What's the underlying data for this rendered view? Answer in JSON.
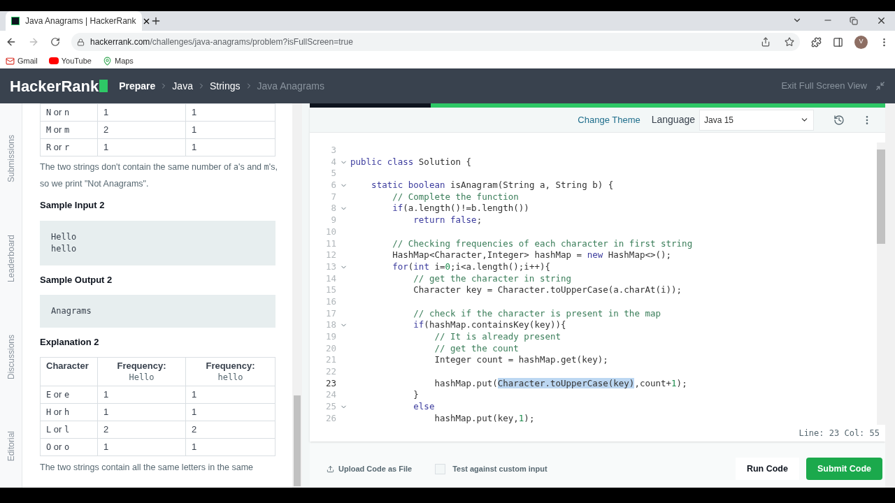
{
  "browser": {
    "tab_title": "Java Anagrams | HackerRank",
    "url_domain": "hackerrank.com",
    "url_path": "/challenges/java-anagrams/problem?isFullScreen=true",
    "bookmarks": [
      "Gmail",
      "YouTube",
      "Maps"
    ],
    "avatar": "V"
  },
  "header": {
    "logo": "HackerRank",
    "breadcrumbs": [
      {
        "label": "Prepare",
        "current": false
      },
      {
        "label": "Java",
        "current": false
      },
      {
        "label": "Strings",
        "current": false
      },
      {
        "label": "Java Anagrams",
        "current": true
      }
    ],
    "exit": "Exit Full Screen View"
  },
  "side_tabs": [
    "Submissions",
    "Leaderboard",
    "Discussions",
    "Editorial"
  ],
  "problem": {
    "table1_rows": [
      {
        "upper": "N",
        "joiner": "or",
        "lower": "n",
        "count_1": "1",
        "count_2": "1"
      },
      {
        "upper": "M",
        "joiner": "or",
        "lower": "m",
        "count_1": "2",
        "count_2": "1"
      },
      {
        "upper": "R",
        "joiner": "or",
        "lower": "r",
        "count_1": "1",
        "count_2": "1"
      }
    ],
    "para1": [
      {
        "text": "The two strings don't contain the same number of ",
        "kind": "text"
      },
      {
        "text": "a",
        "kind": "code"
      },
      {
        "text": "'s and ",
        "kind": "text"
      },
      {
        "text": "m",
        "kind": "code"
      },
      {
        "text": "'s, so we print \"Not Anagrams\".",
        "kind": "text"
      }
    ],
    "sample_input_title": "Sample Input 2",
    "sample_input": [
      "Hello",
      "hello"
    ],
    "sample_output_title": "Sample Output 2",
    "sample_output": [
      "Anagrams"
    ],
    "explanation_title": "Explanation 2",
    "table2_header": [
      {
        "title": "Character"
      },
      {
        "title": "Frequency:",
        "sub": "Hello"
      },
      {
        "title": "Frequency:",
        "sub": "hello"
      }
    ],
    "table2_rows": [
      {
        "upper": "E",
        "joiner": "or",
        "lower": "e",
        "count_1": "1",
        "count_2": "1"
      },
      {
        "upper": "H",
        "joiner": "or",
        "lower": "h",
        "count_1": "1",
        "count_2": "1"
      },
      {
        "upper": "L",
        "joiner": "or",
        "lower": "l",
        "count_1": "2",
        "count_2": "2"
      },
      {
        "upper": "O",
        "joiner": "or",
        "lower": "o",
        "count_1": "1",
        "count_2": "1"
      }
    ],
    "para2": "The two strings contain all the same letters in the same"
  },
  "editor": {
    "change_theme": "Change Theme",
    "language_label": "Language",
    "language": "Java 15",
    "status": "Line: 23 Col: 55",
    "lines": [
      {
        "num": "3",
        "fold": false,
        "current": false
      },
      {
        "num": "4",
        "fold": true,
        "current": false,
        "tokens": [
          {
            "t": "public class",
            "kind": "keyword"
          },
          {
            "t": " Solution {",
            "kind": "plain"
          }
        ]
      },
      {
        "num": "5",
        "fold": false,
        "current": false
      },
      {
        "num": "6",
        "fold": true,
        "current": false,
        "tokens": [
          {
            "t": "    static boolean",
            "kind": "keyword"
          },
          {
            "t": " isAnagram(String a, String b) {",
            "kind": "plain"
          }
        ]
      },
      {
        "num": "7",
        "fold": false,
        "current": false,
        "tokens": [
          {
            "t": "        // Complete the function",
            "kind": "comment"
          }
        ]
      },
      {
        "num": "8",
        "fold": true,
        "current": false,
        "tokens": [
          {
            "t": "        if",
            "kind": "keyword"
          },
          {
            "t": "(a.length()!=b.length())",
            "kind": "plain"
          }
        ]
      },
      {
        "num": "9",
        "fold": false,
        "current": false,
        "tokens": [
          {
            "t": "            return false",
            "kind": "keyword"
          },
          {
            "t": ";",
            "kind": "plain"
          }
        ]
      },
      {
        "num": "10",
        "fold": false,
        "current": false
      },
      {
        "num": "11",
        "fold": false,
        "current": false,
        "tokens": [
          {
            "t": "        // Checking frequencies of each character in first string",
            "kind": "comment"
          }
        ]
      },
      {
        "num": "12",
        "fold": false,
        "current": false,
        "tokens": [
          {
            "t": "        HashMap<Character,Integer> hashMap = ",
            "kind": "plain"
          },
          {
            "t": "new",
            "kind": "keyword"
          },
          {
            "t": " HashMap<>();",
            "kind": "plain"
          }
        ]
      },
      {
        "num": "13",
        "fold": true,
        "current": false,
        "tokens": [
          {
            "t": "        for",
            "kind": "keyword"
          },
          {
            "t": "(",
            "kind": "plain"
          },
          {
            "t": "int",
            "kind": "keyword"
          },
          {
            "t": " i=",
            "kind": "plain"
          },
          {
            "t": "0",
            "kind": "number"
          },
          {
            "t": ";i<a.length();i++){",
            "kind": "plain"
          }
        ]
      },
      {
        "num": "14",
        "fold": false,
        "current": false,
        "tokens": [
          {
            "t": "            // get the character in string",
            "kind": "comment"
          }
        ]
      },
      {
        "num": "15",
        "fold": false,
        "current": false,
        "tokens": [
          {
            "t": "            Character key = Character.toUpperCase(a.charAt(i));",
            "kind": "plain"
          }
        ]
      },
      {
        "num": "16",
        "fold": false,
        "current": false
      },
      {
        "num": "17",
        "fold": false,
        "current": false,
        "tokens": [
          {
            "t": "            // check if the character is present in the map",
            "kind": "comment"
          }
        ]
      },
      {
        "num": "18",
        "fold": true,
        "current": false,
        "tokens": [
          {
            "t": "            if",
            "kind": "keyword"
          },
          {
            "t": "(hashMap.containsKey(key)){",
            "kind": "plain"
          }
        ]
      },
      {
        "num": "19",
        "fold": false,
        "current": false,
        "tokens": [
          {
            "t": "                // It is already present",
            "kind": "comment"
          }
        ]
      },
      {
        "num": "20",
        "fold": false,
        "current": false,
        "tokens": [
          {
            "t": "                // get the count",
            "kind": "comment"
          }
        ]
      },
      {
        "num": "21",
        "fold": false,
        "current": false,
        "tokens": [
          {
            "t": "                Integer count = hashMap.get(key);",
            "kind": "plain"
          }
        ]
      },
      {
        "num": "22",
        "fold": false,
        "current": false
      },
      {
        "num": "23",
        "fold": false,
        "current": true,
        "tokens": [
          {
            "t": "                hashMap.put(",
            "kind": "plain"
          },
          {
            "t": "Character.toUpperCase(key)",
            "kind": "selected"
          },
          {
            "t": ",count+",
            "kind": "plain"
          },
          {
            "t": "1",
            "kind": "number"
          },
          {
            "t": ");",
            "kind": "plain"
          }
        ]
      },
      {
        "num": "24",
        "fold": false,
        "current": false,
        "tokens": [
          {
            "t": "            }",
            "kind": "plain"
          }
        ]
      },
      {
        "num": "25",
        "fold": true,
        "current": false,
        "tokens": [
          {
            "t": "            else",
            "kind": "keyword"
          }
        ]
      },
      {
        "num": "26",
        "fold": false,
        "current": false,
        "tokens": [
          {
            "t": "                hashMap.put(key,",
            "kind": "plain"
          },
          {
            "t": "1",
            "kind": "number"
          },
          {
            "t": ");",
            "kind": "plain"
          }
        ]
      }
    ]
  },
  "footer": {
    "upload": "Upload Code as File",
    "custom_input": {
      "label": "Test against custom input",
      "checked": false
    },
    "run": "Run Code",
    "submit": "Submit Code"
  }
}
